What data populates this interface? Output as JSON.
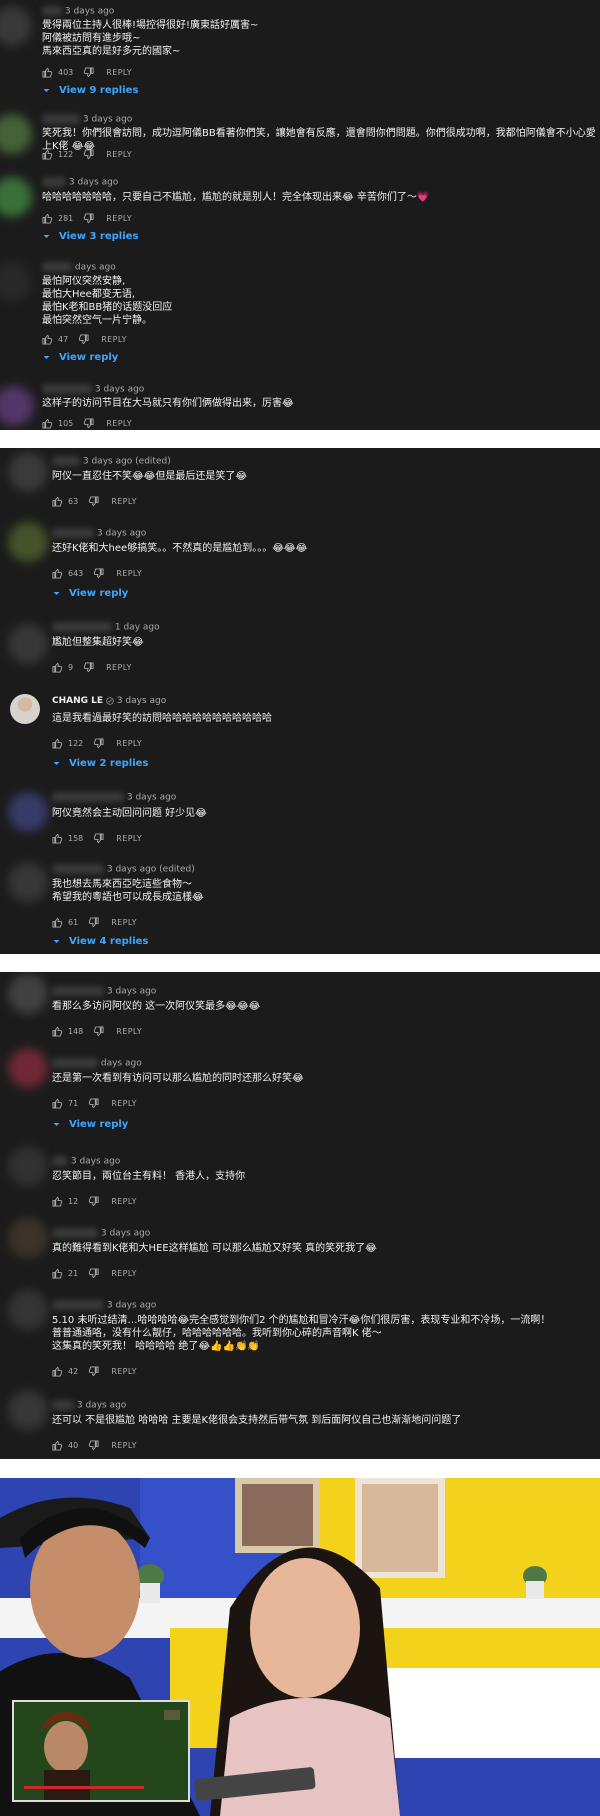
{
  "labels": {
    "reply": "REPLY"
  },
  "panel1": [
    {
      "time": "3 days ago",
      "text": "覺得兩位主持人很棒!場控得很好!廣東話好厲害~\n阿儀被訪問有進步哦~\n馬來西亞真的是好多元的國家~",
      "likes": "403",
      "replies": "View 9 replies"
    },
    {
      "time": "3 days ago",
      "text": "笑死我！你們很會訪問，成功逗阿儀BB看著你們笑，讓她會有反應，還會問你們問題。你們很成功啊，我都怕阿儀會不小心愛上K佬 😂😂",
      "likes": "122",
      "replies": ""
    },
    {
      "time": "3 days ago",
      "text": "哈哈哈哈哈哈哈，只要自己不尴尬，尴尬的就是别人！完全体现出来😂 辛苦你们了～💗",
      "likes": "281",
      "replies": "View 3 replies"
    },
    {
      "time": "days ago",
      "text": "最怕阿仪突然安静,\n最怕大Hee都变无语,\n最怕K老和BB猪的话题没回应\n最怕突然空气一片宁静。",
      "likes": "47",
      "replies": "View reply"
    },
    {
      "time": "3 days ago",
      "text": "这样子的访问节目在大马就只有你们俩做得出来，厉害😂",
      "likes": "105",
      "replies": ""
    }
  ],
  "panel2": [
    {
      "author": "",
      "time": "3 days ago (edited)",
      "text": "阿仪一直忍住不笑😂😂但是最后还是笑了😂",
      "likes": "63",
      "replies": ""
    },
    {
      "author": "",
      "time": "3 days ago",
      "text": "还好K佬和大hee够搞笑。。不然真的是尴尬到。。。😂😂😂",
      "likes": "643",
      "replies": "View reply"
    },
    {
      "author": "",
      "time": "1 day ago",
      "text": "尷尬但整集超好笑😂",
      "likes": "9",
      "replies": ""
    },
    {
      "author": "CHANG LE",
      "time": "3 days ago",
      "text": "這是我看過最好笑的訪問哈哈哈哈哈哈哈哈哈哈哈",
      "likes": "122",
      "replies": "View 2 replies"
    },
    {
      "author": "",
      "time": "3 days ago",
      "text": "阿仪竟然会主动回问问题 好少见😂",
      "likes": "158",
      "replies": ""
    },
    {
      "author": "",
      "time": "3 days ago (edited)",
      "text": "我也想去馬來西亞吃這些食物～\n希望我的粵語也可以成長成這樣😂",
      "likes": "61",
      "replies": "View 4 replies"
    }
  ],
  "panel3": [
    {
      "time": "3 days ago",
      "text": "看那么多访问阿仪的 这一次阿仪笑最多😂😂😂",
      "likes": "148",
      "replies": ""
    },
    {
      "time": "days ago",
      "text": "还是第一次看到有访问可以那么尴尬的同时还那么好笑😂",
      "likes": "71",
      "replies": "View reply"
    },
    {
      "time": "3 days ago",
      "text": "忍笑節目，兩位台主有料！ 香港人，支持你",
      "likes": "12",
      "replies": ""
    },
    {
      "time": "3 days ago",
      "text": "真的難得看到K佬和大HEE这样尴尬 可以那么尴尬又好笑 真的笑死我了😂",
      "likes": "21",
      "replies": ""
    },
    {
      "time": "3 days ago",
      "text": "5.10 未听过结清…哈哈哈哈😂完全感觉到你们2 个的尴尬和冒冷汗😂你们很厉害，表现专业和不冷场，一流啊！\n普普通通咯，没有什么靓仔，哈哈哈哈哈哈。我听到你心碎的声音啊K 佬～\n这集真的笑死我！ 哈哈哈哈 绝了😂👍👍👏👏",
      "likes": "42",
      "replies": ""
    },
    {
      "time": "3 days ago",
      "text": "还可以 不是很尴尬 哈哈哈 主要是K佬很会支持然后带气氛 到后面阿仪自己也渐渐地问问题了",
      "likes": "40",
      "replies": ""
    }
  ],
  "colors": {
    "background": "#1b1b1b",
    "link": "#3ea6ff",
    "meta": "#aaaaaa",
    "text": "#f1f1f1"
  },
  "icons": [
    "thumb-up-icon",
    "thumb-down-icon",
    "chevron-down-icon",
    "verified-icon"
  ]
}
